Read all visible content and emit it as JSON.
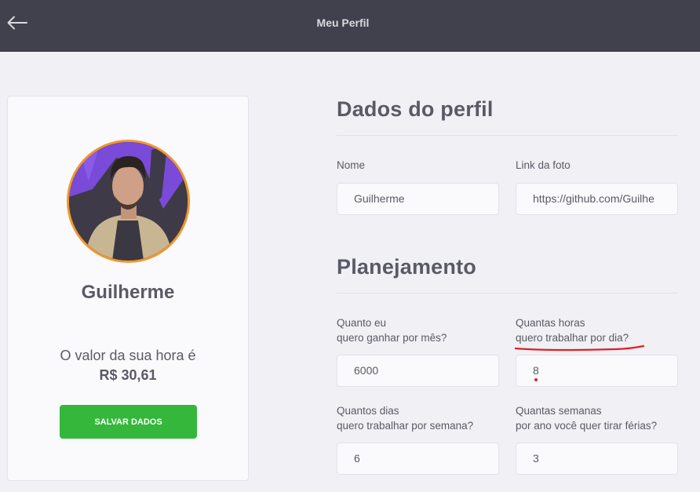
{
  "header": {
    "title": "Meu Perfil",
    "back_icon": "arrow-left-icon"
  },
  "profile_card": {
    "name": "Guilherme",
    "hour_label": "O valor da sua hora é",
    "hour_value": "R$ 30,61",
    "save_label": "SALVAR DADOS"
  },
  "profile_section": {
    "title": "Dados do perfil",
    "name_label": "Nome",
    "name_value": "Guilherme",
    "photo_label": "Link da foto",
    "photo_value": "https://github.com/Guilhe"
  },
  "planning_section": {
    "title": "Planejamento",
    "monthly_label_1": "Quanto eu",
    "monthly_label_2": "quero ganhar por mês?",
    "monthly_value": "6000",
    "hours_label_1": "Quantas horas",
    "hours_label_2": "quero trabalhar por dia?",
    "hours_value": "8",
    "days_label_1": "Quantos dias",
    "days_label_2": "quero trabalhar por semana?",
    "days_value": "6",
    "vacation_label_1": "Quantas semanas",
    "vacation_label_2": "por ano você quer tirar férias?",
    "vacation_value": "3"
  },
  "colors": {
    "header_bg": "#41414d",
    "accent_orange": "#f1972c",
    "button_green": "#34b73b",
    "annotation_red": "#e0202a"
  }
}
